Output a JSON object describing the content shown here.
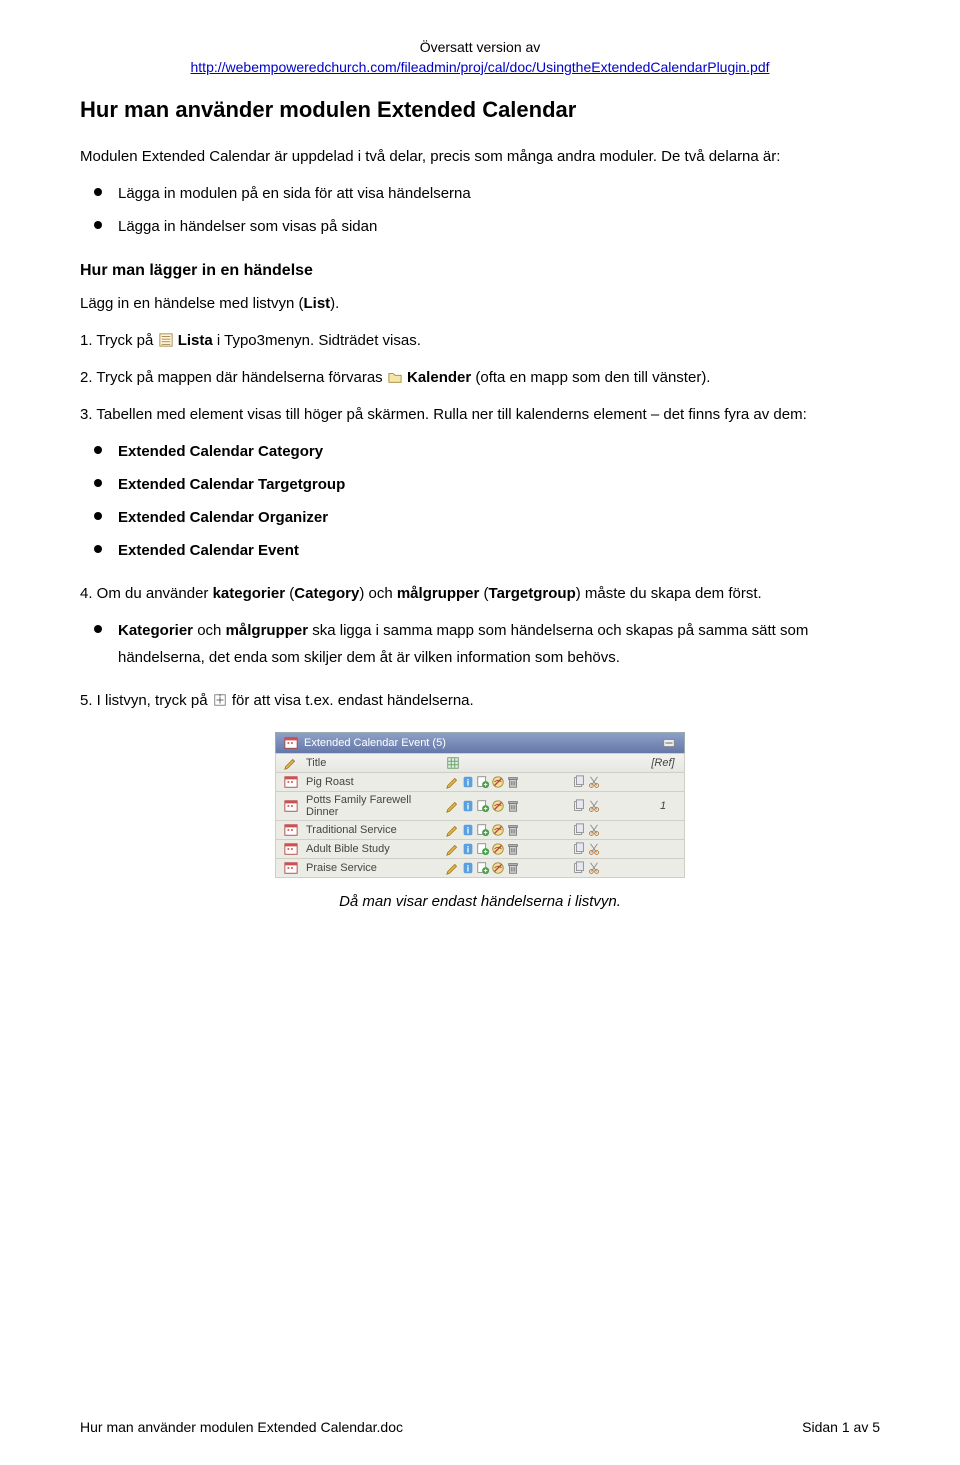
{
  "header": {
    "line1": "Översatt version av",
    "link_text": "http://webempoweredchurch.com/fileadmin/proj/cal/doc/UsingtheExtendedCalendarPlugin.pdf"
  },
  "title": "Hur man använder modulen Extended Calendar",
  "intro": "Modulen Extended Calendar är uppdelad i två delar, precis som många andra moduler. De två delarna är:",
  "intro_bullets": [
    "Lägga in modulen på en sida för att visa händelserna",
    "Lägga in händelser som visas på sidan"
  ],
  "section2_title": "Hur man lägger in en händelse",
  "step_intro_a": "Lägg in en händelse med listvyn (",
  "step_intro_b_bold": "List",
  "step_intro_c": ").",
  "step1_a": "1. Tryck på ",
  "step1_b_bold": " Lista",
  "step1_c": " i Typo3menyn. Sidträdet visas.",
  "step2_a": "2. Tryck på mappen där händelserna förvaras ",
  "step2_b_bold": " Kalender",
  "step2_c": " (ofta en mapp som den till vänster).",
  "step3": "3. Tabellen med element visas till höger på skärmen. Rulla ner till kalenderns element – det finns fyra av dem:",
  "element_bullets": [
    "Extended Calendar Category",
    "Extended Calendar Targetgroup",
    "Extended Calendar Organizer",
    "Extended Calendar Event"
  ],
  "step4_a": "4. Om du använder ",
  "step4_b": "kategorier",
  "step4_c": " (",
  "step4_d": "Category",
  "step4_e": ") och ",
  "step4_f": "målgrupper",
  "step4_g": " (",
  "step4_h": "Targetgroup",
  "step4_i": ") måste du skapa dem först.",
  "step4_sub_a": "Kategorier",
  "step4_sub_b": " och ",
  "step4_sub_c": "målgrupper",
  "step4_sub_d": " ska ligga i samma mapp som händelserna och skapas på samma sätt som händelserna, det enda som skiljer dem åt är vilken information som behövs.",
  "step5_a": "5. I listvyn, tryck på ",
  "step5_b": " för att visa t.ex. endast händelserna.",
  "panel": {
    "header_label": "Extended Calendar Event (5)",
    "title_column": "Title",
    "ref_column": "[Ref]",
    "rows": [
      {
        "title": "Pig Roast",
        "ref": ""
      },
      {
        "title": "Potts Family Farewell Dinner",
        "ref": "1"
      },
      {
        "title": "Traditional Service",
        "ref": ""
      },
      {
        "title": "Adult Bible Study",
        "ref": ""
      },
      {
        "title": "Praise Service",
        "ref": ""
      }
    ]
  },
  "caption": "Då man visar endast händelserna i listvyn.",
  "footer": {
    "left": "Hur man använder modulen Extended Calendar.doc",
    "right": "Sidan 1 av 5"
  }
}
